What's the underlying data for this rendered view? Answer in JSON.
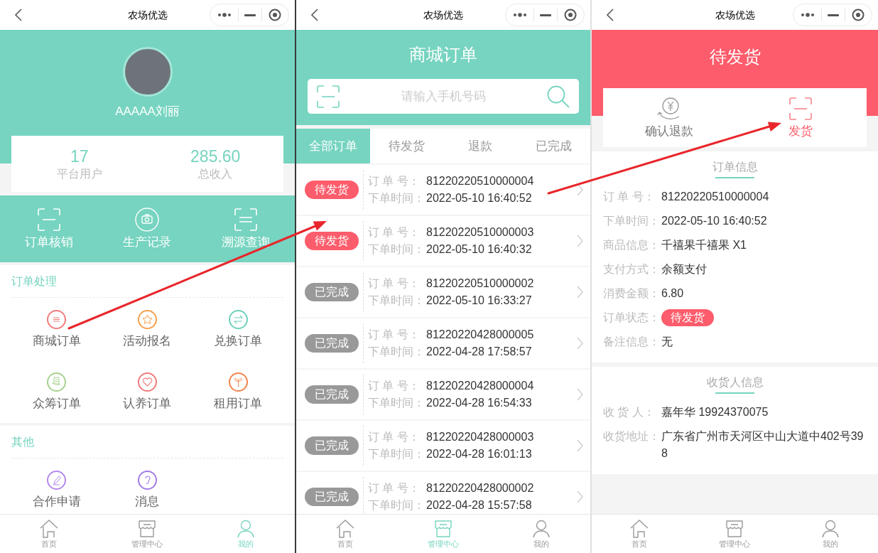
{
  "screens": [
    {
      "kind": "profile",
      "title": "农场优选",
      "user": {
        "name": "AAAAA刘丽"
      },
      "stats": [
        {
          "value": "17",
          "label": "平台用户"
        },
        {
          "value": "285.60",
          "label": "总收入"
        }
      ],
      "quick_actions": [
        "订单核销",
        "生产记录",
        "溯源查询"
      ],
      "sections": [
        {
          "title": "订单处理",
          "items": [
            {
              "label": "商城订单",
              "color": "#f47b7b"
            },
            {
              "label": "活动报名",
              "color": "#f6a04b"
            },
            {
              "label": "兑换订单",
              "color": "#6cd1bb"
            },
            {
              "label": "众筹订单",
              "color": "#a6d18f"
            },
            {
              "label": "认养订单",
              "color": "#f07a7a"
            },
            {
              "label": "租用订单",
              "color": "#f5844c"
            }
          ]
        },
        {
          "title": "其他",
          "items": [
            {
              "label": "合作申请",
              "color": "#b388ee"
            },
            {
              "label": "消息",
              "color": "#a47ae6"
            }
          ]
        }
      ],
      "tab_bar": [
        {
          "label": "首页",
          "selected": false
        },
        {
          "label": "管理中心",
          "selected": false
        },
        {
          "label": "我的",
          "selected": true
        }
      ]
    },
    {
      "kind": "order_list",
      "title": "农场优选",
      "heading": "商城订单",
      "search": {
        "placeholder": "请输入手机号码"
      },
      "tabs": [
        {
          "label": "全部订单",
          "selected": true
        },
        {
          "label": "待发货",
          "selected": false
        },
        {
          "label": "退款",
          "selected": false
        },
        {
          "label": "已完成",
          "selected": false
        }
      ],
      "orders": [
        {
          "status": "待发货",
          "kind": "pending",
          "number_label": "订 单 号：",
          "number": "81220220510000004",
          "time_label": "下单时间：",
          "time": "2022-05-10 16:40:52"
        },
        {
          "status": "待发货",
          "kind": "pending",
          "number_label": "订 单 号：",
          "number": "81220220510000003",
          "time_label": "下单时间：",
          "time": "2022-05-10 16:40:32"
        },
        {
          "status": "已完成",
          "kind": "done",
          "number_label": "订 单 号：",
          "number": "81220220510000002",
          "time_label": "下单时间：",
          "time": "2022-05-10 16:33:27"
        },
        {
          "status": "已完成",
          "kind": "done",
          "number_label": "订 单 号：",
          "number": "81220220428000005",
          "time_label": "下单时间：",
          "time": "2022-04-28 17:58:57"
        },
        {
          "status": "已完成",
          "kind": "done",
          "number_label": "订 单 号：",
          "number": "81220220428000004",
          "time_label": "下单时间：",
          "time": "2022-04-28 16:54:33"
        },
        {
          "status": "已完成",
          "kind": "done",
          "number_label": "订 单 号：",
          "number": "81220220428000003",
          "time_label": "下单时间：",
          "time": "2022-04-28 16:01:13"
        },
        {
          "status": "已完成",
          "kind": "done",
          "number_label": "订 单 号：",
          "number": "81220220428000002",
          "time_label": "下单时间：",
          "time": "2022-04-28 15:57:58"
        }
      ],
      "tab_bar": [
        {
          "label": "首页",
          "selected": false
        },
        {
          "label": "管理中心",
          "selected": true
        },
        {
          "label": "我的",
          "selected": false
        }
      ]
    },
    {
      "kind": "order_detail",
      "title": "农场优选",
      "heading": "待发货",
      "actions": [
        {
          "label": "确认退款",
          "kind": "refund"
        },
        {
          "label": "发货",
          "kind": "ship"
        }
      ],
      "sections": [
        {
          "title": "订单信息",
          "fields": [
            {
              "label": "订 单 号：",
              "value": "81220220510000004",
              "kind": "text"
            },
            {
              "label": "下单时间：",
              "value": "2022-05-10 16:40:52",
              "kind": "text"
            },
            {
              "label": "商品信息：",
              "value": "千禧果千禧果 X1",
              "kind": "text"
            },
            {
              "label": "支付方式：",
              "value": "余额支付",
              "kind": "text"
            },
            {
              "label": "消费金额：",
              "value": "6.80",
              "kind": "text"
            },
            {
              "label": "订单状态：",
              "value": "待发货",
              "kind": "status"
            },
            {
              "label": "备注信息：",
              "value": "无",
              "kind": "text"
            }
          ]
        },
        {
          "title": "收货人信息",
          "fields": [
            {
              "label": "收 货 人：",
              "value": "嘉年华 19924370075",
              "kind": "text"
            },
            {
              "label": "收货地址：",
              "value": "广东省广州市天河区中山大道中402号398",
              "kind": "text"
            }
          ]
        }
      ],
      "tab_bar": [
        {
          "label": "首页",
          "selected": false
        },
        {
          "label": "管理中心",
          "selected": false
        },
        {
          "label": "我的",
          "selected": false
        }
      ]
    }
  ]
}
